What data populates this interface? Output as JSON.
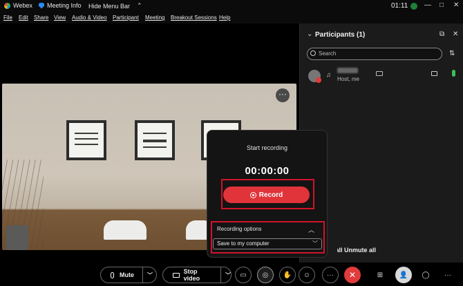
{
  "titlebar": {
    "app_name": "Webex",
    "meeting_info": "Meeting Info",
    "hide_menu": "Hide Menu Bar",
    "chevron": "⌃",
    "time": "01:11",
    "minimize": "—",
    "maximize": "□",
    "close": "✕"
  },
  "menubar": {
    "items": [
      "File",
      "Edit",
      "Share",
      "View",
      "Audio & Video",
      "Participant",
      "Meeting",
      "Breakout Sessions",
      "Help"
    ]
  },
  "video": {
    "more": "···"
  },
  "participants": {
    "title": "Participants (1)",
    "search_placeholder": "Search",
    "list": [
      {
        "role": "Host, me"
      }
    ],
    "mute_all": "Mute all",
    "unmute_all": "Unmute all"
  },
  "recording": {
    "title": "Start recording",
    "timer": "00:00:00",
    "record_label": "Record",
    "options_label": "Recording options",
    "save_option": "Save to my computer"
  },
  "controls": {
    "mute_label": "Mute",
    "stop_video_label": "Stop video",
    "more": "···"
  },
  "colors": {
    "accent_red": "#e0343a",
    "highlight_red": "#d0132a",
    "end_red": "#e23b3b",
    "mic_green": "#3cbf5a"
  }
}
